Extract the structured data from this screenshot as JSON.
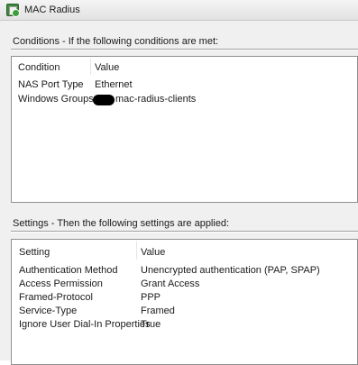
{
  "window": {
    "title": "MAC Radius",
    "icon": "network-policy-icon"
  },
  "conditions": {
    "heading": "Conditions - If the following conditions are met:",
    "columns": [
      "Condition",
      "Value"
    ],
    "rows": [
      {
        "name": "NAS Port Type",
        "value": "Ethernet"
      },
      {
        "name": "Windows Groups",
        "value": "mac-radius-clients",
        "redacted_prefix": true
      }
    ]
  },
  "settings": {
    "heading": "Settings - Then the following settings are applied:",
    "columns": [
      "Setting",
      "Value"
    ],
    "rows": [
      {
        "name": "Authentication Method",
        "value": "Unencrypted authentication (PAP, SPAP)"
      },
      {
        "name": "Access Permission",
        "value": "Grant Access"
      },
      {
        "name": "Framed-Protocol",
        "value": "PPP"
      },
      {
        "name": "Service-Type",
        "value": "Framed"
      },
      {
        "name": "Ignore User Dial-In Properties",
        "value": "True"
      }
    ]
  }
}
